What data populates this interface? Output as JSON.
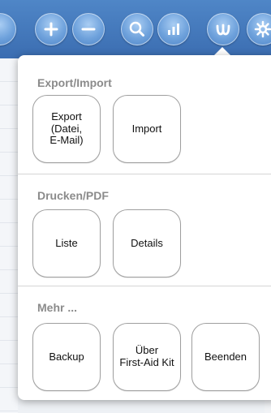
{
  "toolbar": {
    "buttons": [
      {
        "icon": "partial-button-icon"
      },
      {
        "icon": "plus-icon"
      },
      {
        "icon": "minus-icon"
      },
      {
        "icon": "search-icon"
      },
      {
        "icon": "bar-chart-icon"
      },
      {
        "icon": "share-icon"
      },
      {
        "icon": "gear-icon"
      }
    ],
    "colors": {
      "bar": "#3b6db1",
      "button": "#6fa2dc"
    }
  },
  "popover": {
    "sections": [
      {
        "title": "Export/Import",
        "buttons": [
          {
            "label": "Export\n(Datei,\nE-Mail)"
          },
          {
            "label": "Import"
          }
        ]
      },
      {
        "title": "Drucken/PDF",
        "buttons": [
          {
            "label": "Liste"
          },
          {
            "label": "Details"
          }
        ]
      },
      {
        "title": "Mehr ...",
        "buttons": [
          {
            "label": "Backup"
          },
          {
            "label": "Über\nFirst-Aid Kit"
          },
          {
            "label": "Beenden"
          }
        ]
      }
    ]
  }
}
